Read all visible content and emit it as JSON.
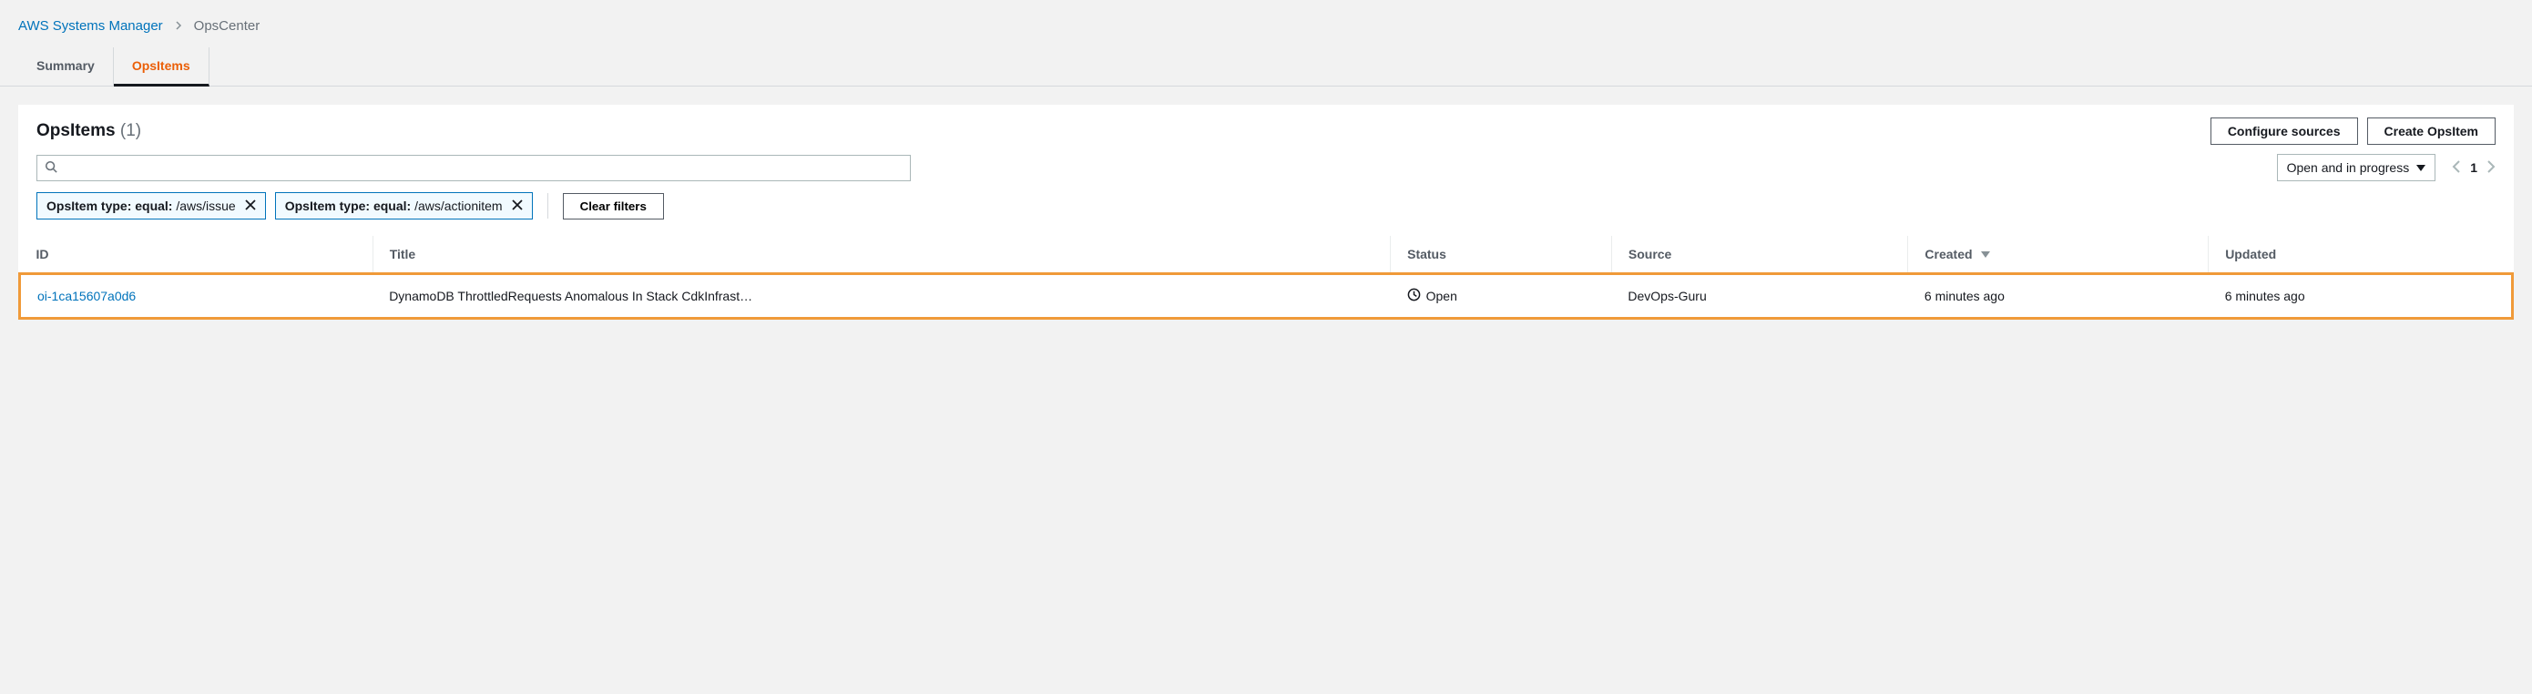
{
  "breadcrumb": {
    "root": "AWS Systems Manager",
    "current": "OpsCenter"
  },
  "tabs": {
    "summary": "Summary",
    "opsitems": "OpsItems"
  },
  "panel": {
    "title": "OpsItems",
    "count": "(1)",
    "configure_sources": "Configure sources",
    "create_opsitem": "Create OpsItem"
  },
  "search": {
    "placeholder": ""
  },
  "status_filter": {
    "label": "Open and in progress"
  },
  "pagination": {
    "page": "1"
  },
  "chips": [
    {
      "label": "OpsItem type: equal:",
      "value": "/aws/issue"
    },
    {
      "label": "OpsItem type: equal:",
      "value": "/aws/actionitem"
    }
  ],
  "clear_filters": "Clear filters",
  "table": {
    "headers": {
      "id": "ID",
      "title": "Title",
      "status": "Status",
      "source": "Source",
      "created": "Created",
      "updated": "Updated"
    },
    "rows": [
      {
        "id": "oi-1ca15607a0d6",
        "title": "DynamoDB ThrottledRequests Anomalous In Stack CdkInfrast…",
        "status": "Open",
        "source": "DevOps-Guru",
        "created": "6 minutes ago",
        "updated": "6 minutes ago"
      }
    ]
  }
}
